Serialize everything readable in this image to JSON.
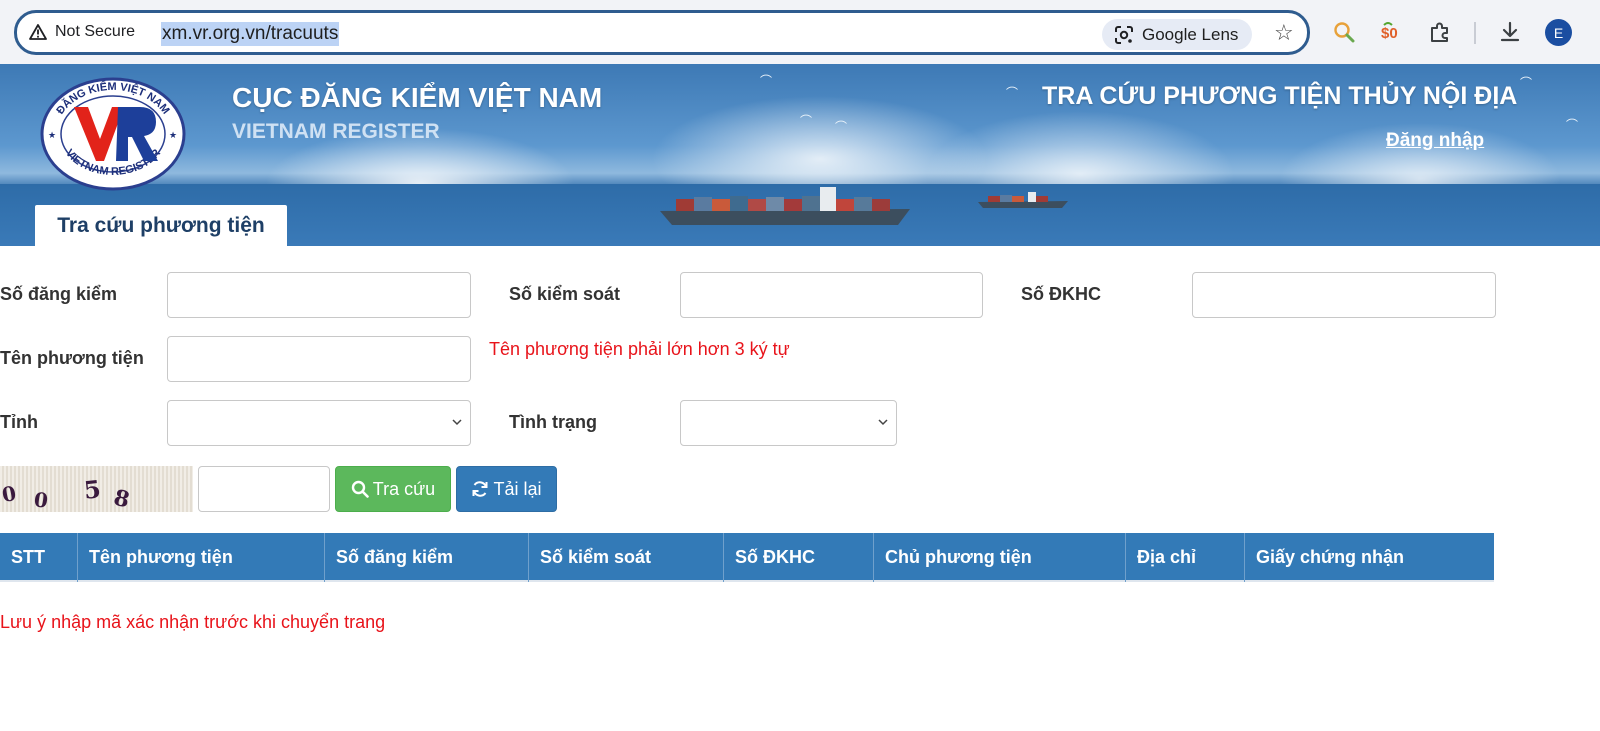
{
  "browser": {
    "security_label": "Not Secure",
    "url": "xm.vr.org.vn/tracuuts",
    "lens_label": "Google Lens",
    "profile_initial": "E"
  },
  "banner": {
    "title": "CỤC ĐĂNG KIỂM VIỆT NAM",
    "subtitle": "VIETNAM REGISTER",
    "right_title": "TRA CỨU PHƯƠNG TIỆN THỦY NỘI ĐỊA",
    "login": "Đăng nhập",
    "logo_text_top": "ĐĂNG KIỂM VIỆT NAM",
    "logo_text_bottom": "VIETNAM REGISTER",
    "logo_mark": "VR",
    "tab": "Tra cứu phương tiện"
  },
  "form": {
    "so_dang_kiem": {
      "label": "Số đăng kiểm",
      "value": ""
    },
    "so_kiem_soat": {
      "label": "Số kiểm soát",
      "value": ""
    },
    "so_dkhc": {
      "label": "Số ĐKHC",
      "value": ""
    },
    "ten_phuong_tien": {
      "label": "Tên phương tiện",
      "value": ""
    },
    "error_ten": "Tên phương tiện phải lớn hơn 3 ký tự",
    "tinh": {
      "label": "Tỉnh",
      "selected": ""
    },
    "tinh_trang": {
      "label": "Tình trạng",
      "selected": ""
    },
    "captcha_chars": [
      "0",
      "0",
      "5",
      "8"
    ],
    "captcha_value": "",
    "search_button": "Tra cứu",
    "reload_button": "Tải lại"
  },
  "table": {
    "headers": [
      "STT",
      "Tên phương tiện",
      "Số đăng kiểm",
      "Số kiểm soát",
      "Số ĐKHC",
      "Chủ phương tiện",
      "Địa chỉ",
      "Giấy chứng nhận"
    ],
    "rows": []
  },
  "note": "Lưu ý nhập mã xác nhận trước khi chuyển trang",
  "colors": {
    "primary": "#337ab7",
    "success": "#5cb85c",
    "error": "#e8131a",
    "tab_text": "#1e3f66"
  }
}
